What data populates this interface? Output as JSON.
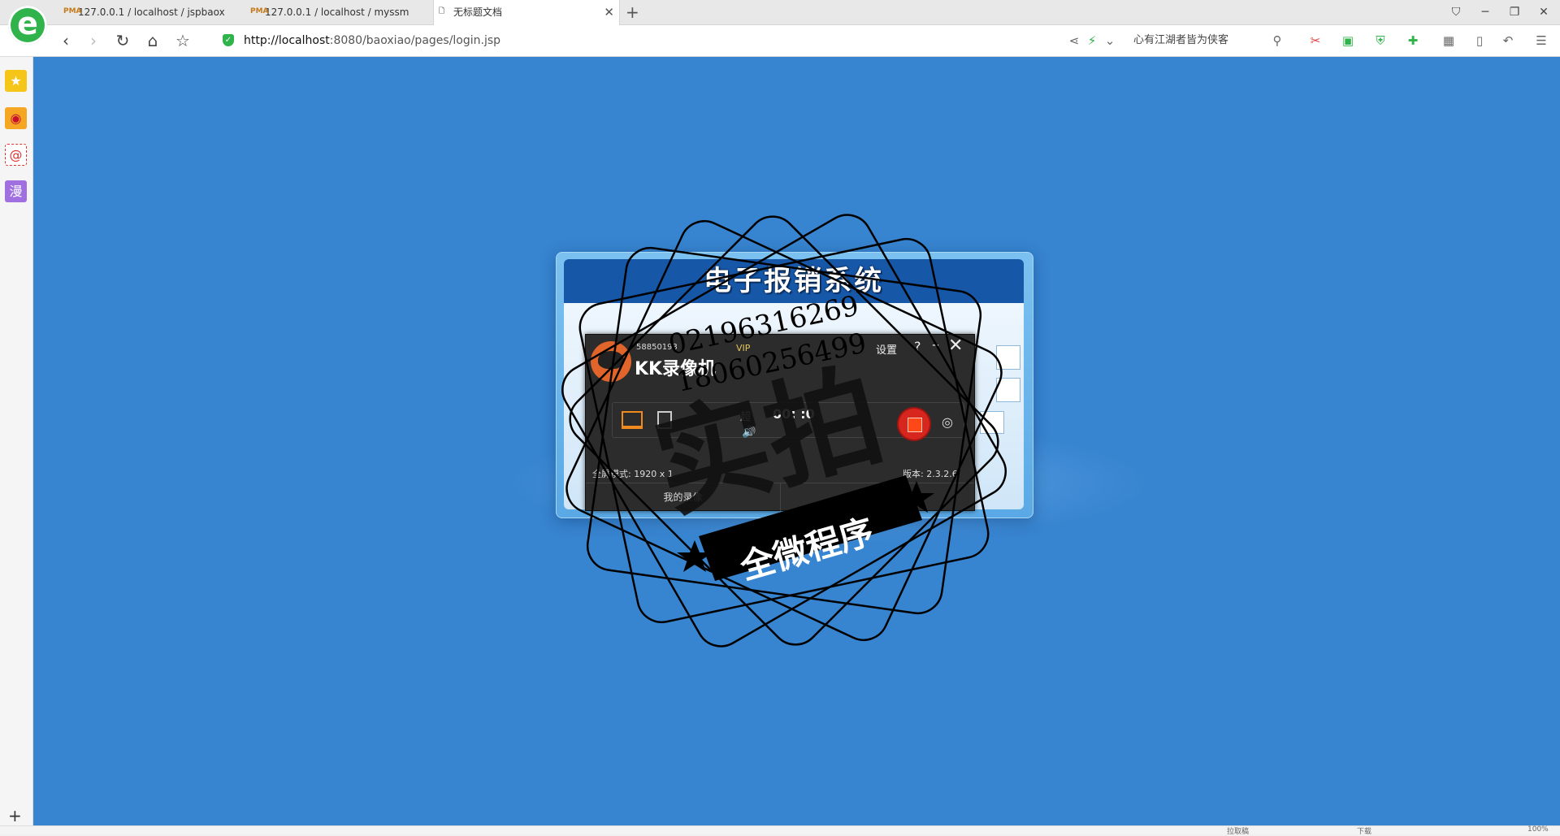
{
  "tabs": [
    {
      "favicon": "PMA",
      "label": "127.0.0.1 / localhost / jspbaox"
    },
    {
      "favicon": "PMA",
      "label": "127.0.0.1 / localhost / myssm"
    },
    {
      "favicon": "document-icon",
      "label": "无标题文档"
    }
  ],
  "toolbar": {
    "url_host": "http://localhost",
    "url_rest": ":8080/baoxiao/pages/login.jsp",
    "search_text": "心有江湖者皆为侠客"
  },
  "login": {
    "title": "电子报销系统"
  },
  "recorder": {
    "account_id": "58850193",
    "vip": "VIP",
    "brand": "KK录像机",
    "settings": "设置",
    "help": "?",
    "timer_label": "超",
    "timer": "00: :0",
    "mode": "全屏模式: 1920 x 1",
    "version": "版本: 2.3.2.6",
    "footer_left": "我的录像"
  },
  "watermark": {
    "phone1": "02196316269",
    "phone2": "18060256499",
    "main": "实拍",
    "banner": "全微程序"
  },
  "status": {
    "items": [
      "拉取稿",
      "下载",
      "100%"
    ]
  },
  "colors": {
    "page_bg": "#3784d0",
    "title_bar": "#1657a8",
    "record": "#d7261e"
  }
}
